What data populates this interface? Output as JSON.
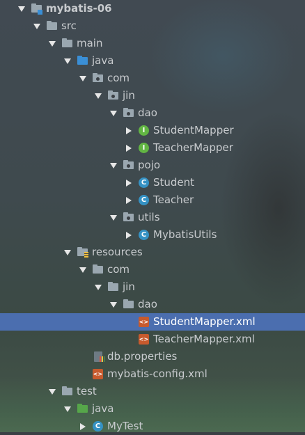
{
  "project_tree": {
    "nodes": [
      {
        "label": "mybatis-06",
        "level": 0,
        "expander": "down",
        "icon": "module-folder-icon",
        "bold": true,
        "selected": false
      },
      {
        "label": "src",
        "level": 1,
        "expander": "down",
        "icon": "folder-icon",
        "selected": false
      },
      {
        "label": "main",
        "level": 2,
        "expander": "down",
        "icon": "folder-icon",
        "selected": false
      },
      {
        "label": "java",
        "level": 3,
        "expander": "down",
        "icon": "source-root-folder-icon",
        "selected": false
      },
      {
        "label": "com",
        "level": 4,
        "expander": "down",
        "icon": "package-icon",
        "selected": false
      },
      {
        "label": "jin",
        "level": 5,
        "expander": "down",
        "icon": "package-icon",
        "selected": false
      },
      {
        "label": "dao",
        "level": 6,
        "expander": "down",
        "icon": "package-icon",
        "selected": false
      },
      {
        "label": "StudentMapper",
        "level": 7,
        "expander": "right",
        "icon": "interface-icon",
        "selected": false
      },
      {
        "label": "TeacherMapper",
        "level": 7,
        "expander": "right",
        "icon": "interface-icon",
        "selected": false
      },
      {
        "label": "pojo",
        "level": 6,
        "expander": "down",
        "icon": "package-icon",
        "selected": false
      },
      {
        "label": "Student",
        "level": 7,
        "expander": "right",
        "icon": "class-icon",
        "selected": false
      },
      {
        "label": "Teacher",
        "level": 7,
        "expander": "right",
        "icon": "class-icon",
        "selected": false
      },
      {
        "label": "utils",
        "level": 6,
        "expander": "down",
        "icon": "package-icon",
        "selected": false
      },
      {
        "label": "MybatisUtils",
        "level": 7,
        "expander": "right",
        "icon": "class-icon",
        "selected": false
      },
      {
        "label": "resources",
        "level": 3,
        "expander": "down",
        "icon": "resources-folder-icon",
        "selected": false
      },
      {
        "label": "com",
        "level": 4,
        "expander": "down",
        "icon": "folder-icon",
        "selected": false
      },
      {
        "label": "jin",
        "level": 5,
        "expander": "down",
        "icon": "folder-icon",
        "selected": false
      },
      {
        "label": "dao",
        "level": 6,
        "expander": "down",
        "icon": "folder-icon",
        "selected": false
      },
      {
        "label": "StudentMapper.xml",
        "level": 7,
        "expander": "none",
        "icon": "xml-file-icon",
        "selected": true
      },
      {
        "label": "TeacherMapper.xml",
        "level": 7,
        "expander": "none",
        "icon": "xml-file-icon",
        "selected": false
      },
      {
        "label": "db.properties",
        "level": 4,
        "expander": "none",
        "icon": "properties-file-icon",
        "selected": false
      },
      {
        "label": "mybatis-config.xml",
        "level": 4,
        "expander": "none",
        "icon": "xml-file-icon",
        "selected": false
      },
      {
        "label": "test",
        "level": 2,
        "expander": "down",
        "icon": "folder-icon",
        "selected": false
      },
      {
        "label": "java",
        "level": 3,
        "expander": "down",
        "icon": "test-root-folder-icon",
        "selected": false
      },
      {
        "label": "MyTest",
        "level": 4,
        "expander": "right",
        "icon": "class-icon",
        "selected": false
      }
    ]
  },
  "colors": {
    "selection": "#4b6eaf",
    "text": "#c8cbce",
    "interface": "#62b543",
    "class": "#3592c4",
    "xml": "#c75a2d"
  }
}
